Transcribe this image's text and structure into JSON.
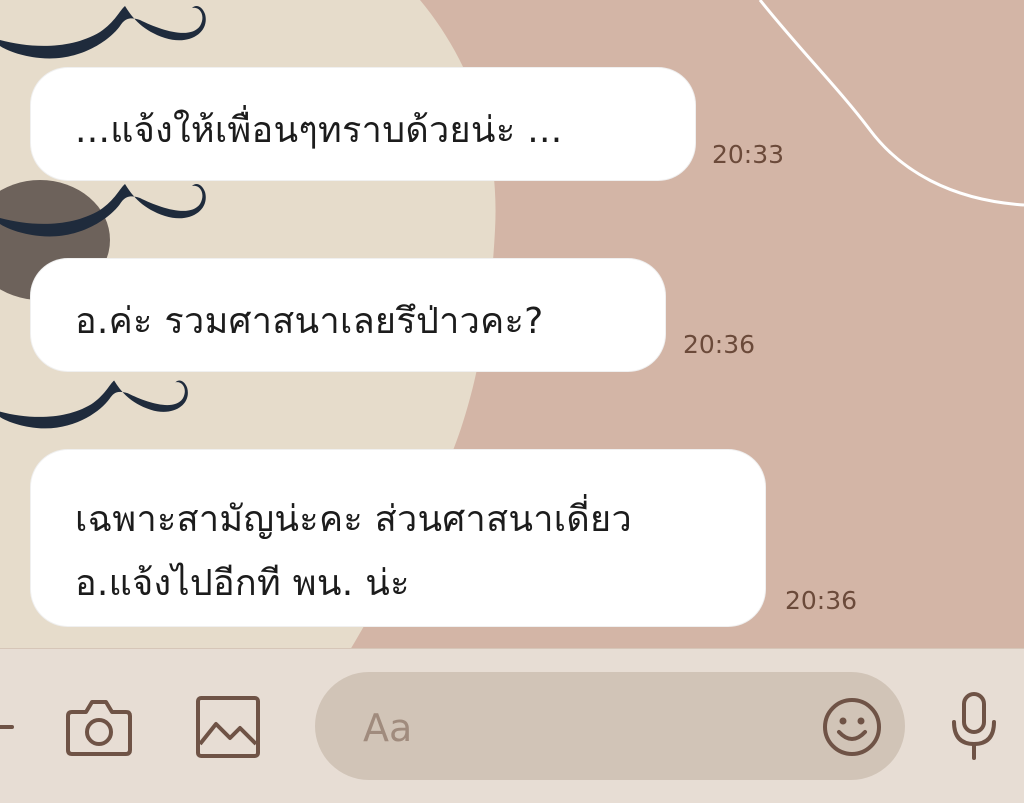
{
  "messages": [
    {
      "lines": [
        "...แจ้งให้เพื่อนๆทราบด้วยน่ะ ..."
      ],
      "time": "20:33"
    },
    {
      "lines": [
        "อ.ค่ะ รวมศาสนาเลยรึป่าวคะ?"
      ],
      "time": "20:36"
    },
    {
      "lines": [
        "เฉพาะสามัญน่ะคะ ส่วนศาสนาเดี่ยว",
        "อ.แจ้งไปอีกที พน. น่ะ"
      ],
      "time": "20:36"
    }
  ],
  "composer": {
    "placeholder": "Aa",
    "icons": [
      "plus-icon",
      "camera-icon",
      "image-icon",
      "emoji-icon",
      "microphone-icon"
    ]
  },
  "colors": {
    "background": "#d3b5a6",
    "background_blob": "#e6dccb",
    "bubble": "#ffffff",
    "timestamp": "#6b4a3a",
    "composer_bar": "#e7ddd4",
    "input_pill": "#d1c4b7",
    "icon": "#6f5346",
    "mustache": "#1f2b3c"
  }
}
